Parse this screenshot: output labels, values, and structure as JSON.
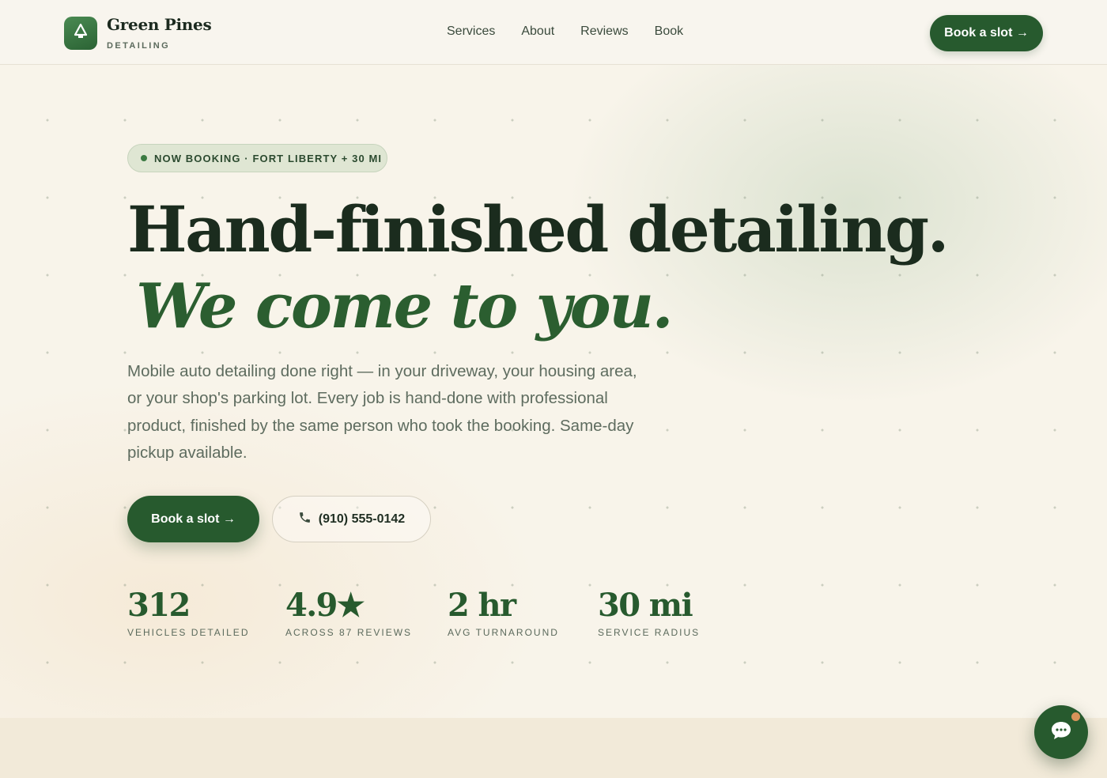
{
  "brand": {
    "name": "Green Pines",
    "sub": "DETAILING",
    "logo_icon": "pine-tree-icon"
  },
  "nav": {
    "items": [
      "Services",
      "About",
      "Reviews",
      "Book"
    ]
  },
  "header_cta": {
    "label": "Book a slot →"
  },
  "hero": {
    "badge": "NOW BOOKING · FORT LIBERTY + 30 MI",
    "headline": "Hand-finished detailing.",
    "headline_italic": "We come to you.",
    "lead": "Mobile auto detailing done right — in your driveway, your housing area, or your shop's parking lot. Every job is hand-done with professional product, finished by the same person who took the booking. Same-day pickup available.",
    "primary_cta": "Book a slot →",
    "phone": "(910) 555-0142",
    "phone_icon": "phone-icon"
  },
  "stats": [
    {
      "value": "312",
      "label": "VEHICLES DETAILED"
    },
    {
      "value": "4.9★",
      "label": "ACROSS 87 REVIEWS"
    },
    {
      "value": "2 hr",
      "label": "AVG TURNAROUND"
    },
    {
      "value": "30 mi",
      "label": "SERVICE RADIUS"
    }
  ],
  "chat": {
    "icon": "chat-bubble-icon",
    "has_notification": true
  },
  "colors": {
    "brand_green": "#275a2e",
    "text_dark": "#1b2c1e",
    "background": "#f8f4ea",
    "notification": "#d9935a"
  }
}
